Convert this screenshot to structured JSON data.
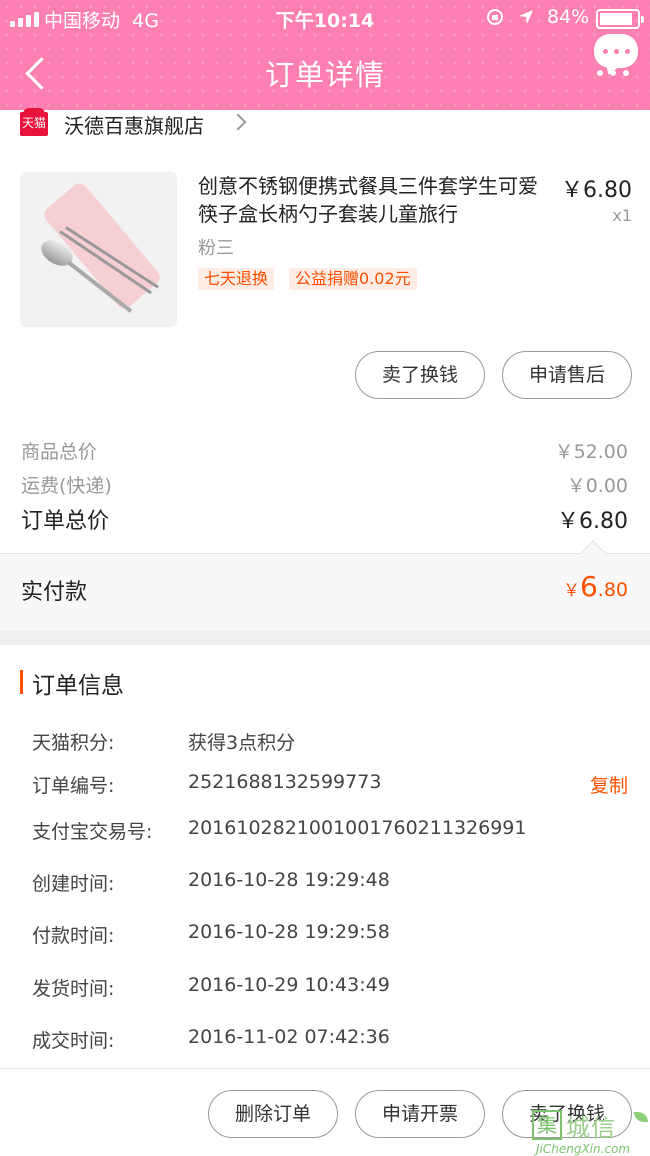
{
  "status_bar": {
    "carrier": "中国移动",
    "network": "4G",
    "time": "下午10:14",
    "battery": "84%"
  },
  "nav": {
    "title": "订单详情"
  },
  "store": {
    "badge": "天猫",
    "name": "沃德百惠旗舰店"
  },
  "product": {
    "title": "创意不锈钢便携式餐具三件套学生可爱筷子盒长柄勺子套装儿童旅行",
    "price": "￥6.80",
    "quantity": "x1",
    "sku": "粉三",
    "tags": [
      "七天退换",
      "公益捐赠0.02元"
    ]
  },
  "product_actions": {
    "sell": "卖了换钱",
    "after_sale": "申请售后"
  },
  "prices": {
    "goods_label": "商品总价",
    "goods_value": "￥52.00",
    "shipping_label": "运费(快递)",
    "shipping_value": "￥0.00",
    "total_label": "订单总价",
    "total_value": "￥6.80",
    "paid_label": "实付款",
    "paid_currency": "￥",
    "paid_integer": "6",
    "paid_decimal": ".80"
  },
  "order_info": {
    "title": "订单信息",
    "points_label": "天猫积分:",
    "points_value": "获得3点积分",
    "order_no_label": "订单编号:",
    "order_no_value": "2521688132599773",
    "copy_label": "复制",
    "alipay_label": "支付宝交易号:",
    "alipay_value": "2016102821001001760211326991",
    "created_label": "创建时间:",
    "created_value": "2016-10-28 19:29:48",
    "paid_time_label": "付款时间:",
    "paid_time_value": "2016-10-28 19:29:58",
    "shipped_label": "发货时间:",
    "shipped_value": "2016-10-29 10:43:49",
    "deal_label": "成交时间:",
    "deal_value": "2016-11-02 07:42:36"
  },
  "bottom_actions": {
    "delete": "删除订单",
    "invoice": "申请开票",
    "sell": "卖了换钱"
  },
  "watermark": {
    "logo_char": "集",
    "text": "城信",
    "url": "JiChengXin.com"
  },
  "colors": {
    "header_pink": "#fb7fb0",
    "accent_orange": "#ff5000"
  }
}
